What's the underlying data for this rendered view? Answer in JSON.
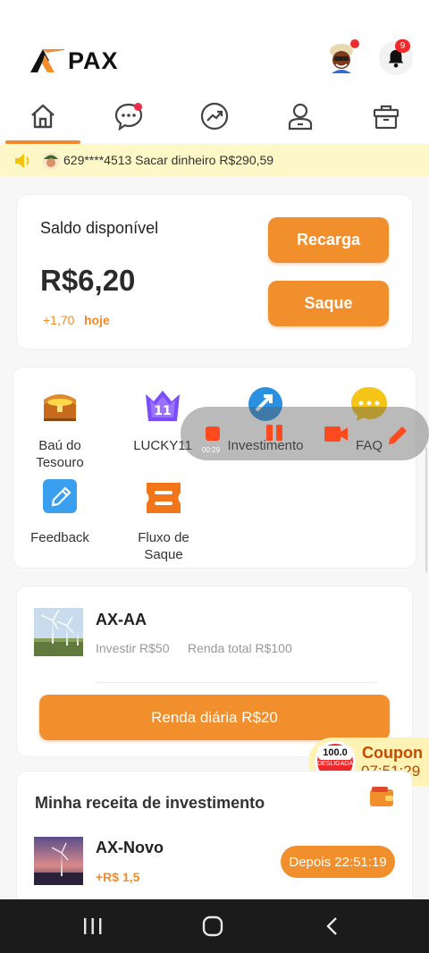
{
  "app": {
    "name": "PAX",
    "brand_color": "#f28f2d",
    "accent_color": "#f08a2b"
  },
  "header": {
    "notification_count": "9"
  },
  "nav": {
    "items": [
      {
        "icon": "home-icon",
        "active": true
      },
      {
        "icon": "chat-icon",
        "active": false
      },
      {
        "icon": "trend-icon",
        "active": false
      },
      {
        "icon": "profile-icon",
        "active": false
      },
      {
        "icon": "gift-icon",
        "active": false
      }
    ]
  },
  "ticker": {
    "icon": "speaker-icon",
    "text": "629****4513 Sacar dinheiro R$290,59"
  },
  "balance": {
    "label": "Saldo disponível",
    "value": "R$6,20",
    "change": "+1,70",
    "change_suffix": "hoje",
    "recharge_label": "Recarga",
    "withdraw_label": "Saque"
  },
  "features": [
    {
      "icon": "treasure-chest-icon",
      "label": "Baú do Tesouro"
    },
    {
      "icon": "crown-icon",
      "label": "LUCKY11",
      "icon_text": "11"
    },
    {
      "icon": "investment-icon",
      "label": "Investimento"
    },
    {
      "icon": "faq-icon",
      "label": "FAQ"
    },
    {
      "icon": "feedback-icon",
      "label": "Feedback"
    },
    {
      "icon": "withdraw-flow-icon",
      "label": "Fluxo de Saque"
    }
  ],
  "recorder": {
    "time": "00:29"
  },
  "product": {
    "name": "AX-AA",
    "invest": "Investir R$50",
    "total": "Renda total R$100",
    "daily_button": "Renda diária R$20"
  },
  "coupon": {
    "badge_value": "100.0",
    "badge_status": "DESLIGADA",
    "title": "Coupon",
    "timer": "07:51:29"
  },
  "income": {
    "title": "Minha receita de investimento",
    "item_name": "AX-Novo",
    "item_amount": "+R$ 1,5",
    "item_status": "Depois 22:51:19"
  }
}
